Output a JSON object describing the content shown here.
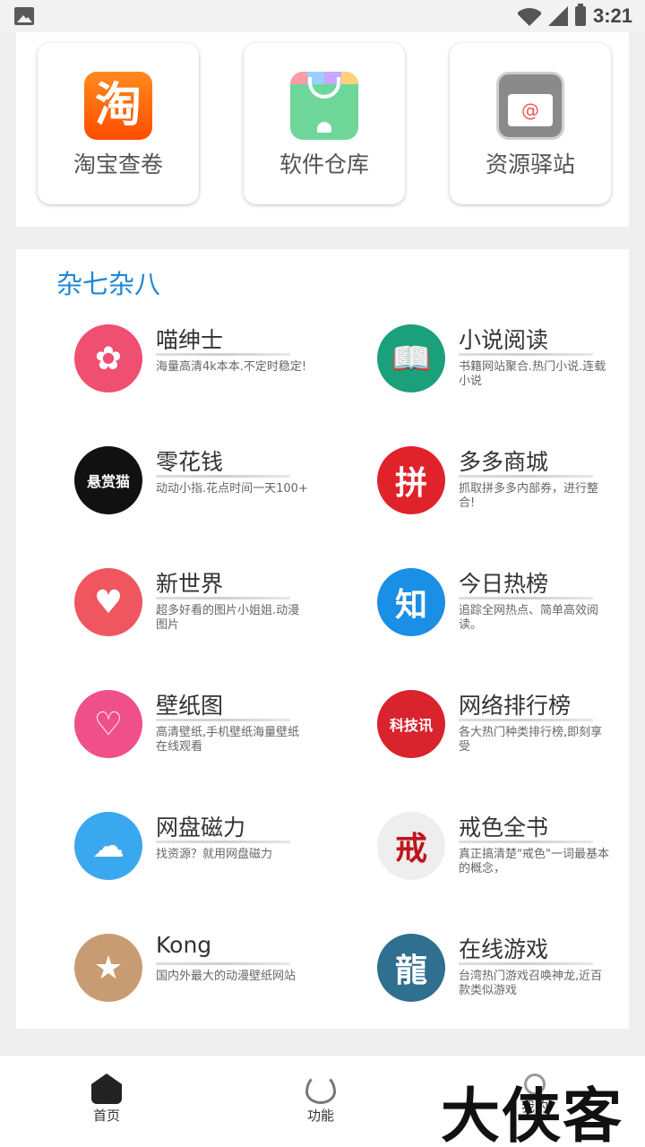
{
  "status_bar": {
    "time": "3:21"
  },
  "top_apps": [
    {
      "label": "淘宝查卷",
      "icon": "taobao-icon",
      "glyph": "淘"
    },
    {
      "label": "软件仓库",
      "icon": "software-store-icon"
    },
    {
      "label": "资源驿站",
      "icon": "resource-station-icon",
      "glyph": "@"
    }
  ],
  "section": {
    "title": "杂七杂八",
    "items": [
      {
        "name": "喵绅士",
        "desc": "海量高清4k本本.不定时稳定!",
        "color": "#ef4f70",
        "glyph": "✿"
      },
      {
        "name": "小说阅读",
        "desc": "书籍网站聚合.热门小说.连载小说",
        "color": "#1aa07a",
        "glyph": "📖"
      },
      {
        "name": "零花钱",
        "desc": "动动小指.花点时间一天100+",
        "color": "#111111",
        "glyph": "悬赏猫"
      },
      {
        "name": "多多商城",
        "desc": "抓取拼多多内部券，进行整合!",
        "color": "#e0232b",
        "glyph": "拼"
      },
      {
        "name": "新世界",
        "desc": "超多好看的图片小姐姐.动漫图片",
        "color": "#ef5660",
        "glyph": "♥"
      },
      {
        "name": "今日热榜",
        "desc": "追踪全网热点、简单高效阅读。",
        "color": "#1a8fe6",
        "glyph": "知"
      },
      {
        "name": "壁纸图",
        "desc": "高清壁纸,手机壁纸海量壁纸在线观看",
        "color": "#f0508a",
        "glyph": "♡"
      },
      {
        "name": "网络排行榜",
        "desc": "各大热门种类排行榜,即刻享受",
        "color": "#d9232d",
        "glyph": "科技讯"
      },
      {
        "name": "网盘磁力",
        "desc": "找资源？就用网盘磁力",
        "color": "#3aa8ee",
        "glyph": "☁"
      },
      {
        "name": "戒色全书",
        "desc": "真正搞清楚\"戒色\"一词最基本的概念，",
        "color": "#eeeeee",
        "glyph": "戒"
      },
      {
        "name": "Kong",
        "desc": "国内外最大的动漫壁纸网站",
        "color": "#c89c72",
        "glyph": "★"
      },
      {
        "name": "在线游戏",
        "desc": "台湾热门游戏召唤神龙,近百款类似游戏",
        "color": "#2f6f8f",
        "glyph": "龍"
      }
    ]
  },
  "bottom_nav": [
    {
      "label": "首页",
      "icon": "home-icon"
    },
    {
      "label": "功能",
      "icon": "fire-icon"
    },
    {
      "label": "我的",
      "icon": "profile-icon"
    }
  ],
  "watermark": "大侠客"
}
